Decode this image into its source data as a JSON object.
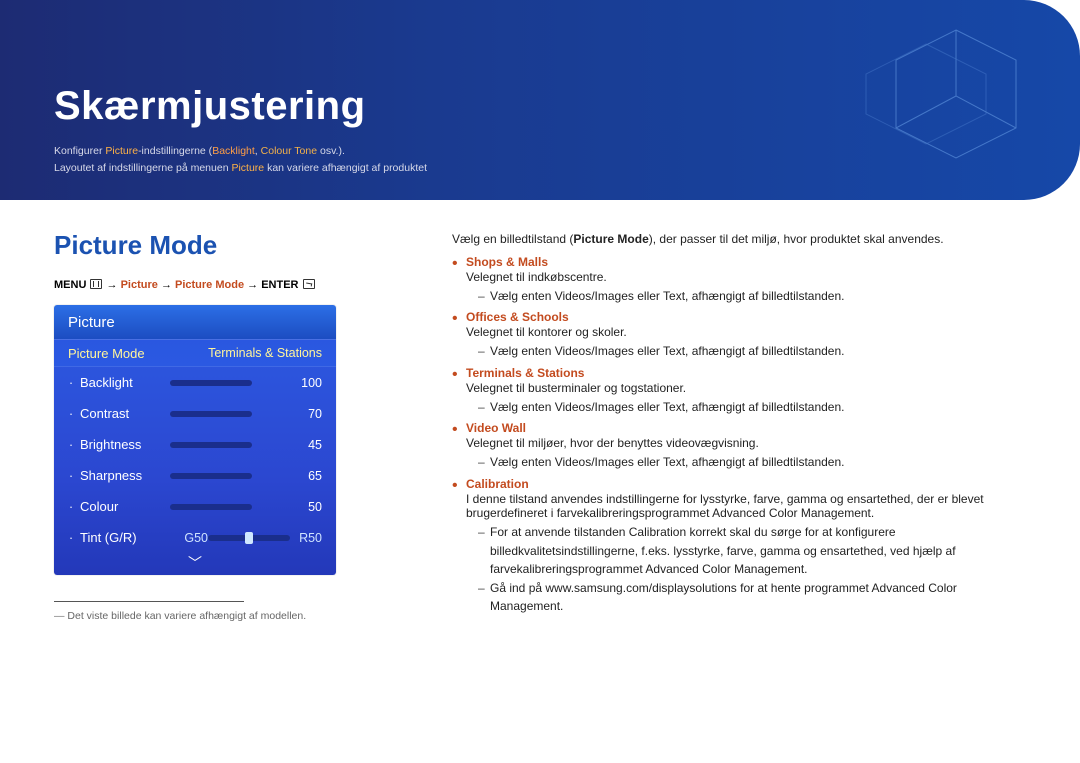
{
  "header": {
    "title": "Skærmjustering",
    "sub1_a": "Konfigurer ",
    "sub1_b": "Picture",
    "sub1_c": "-indstillingerne (",
    "sub1_d": "Backlight",
    "sub1_e": ", ",
    "sub1_f": "Colour Tone",
    "sub1_g": " osv.).",
    "sub2_a": "Layoutet af indstillingerne på menuen ",
    "sub2_b": "Picture",
    "sub2_c": " kan variere afhængigt af produktet"
  },
  "left": {
    "section_title": "Picture Mode",
    "bc_menu": "MENU",
    "bc_arrow": "→",
    "bc_picture": "Picture",
    "bc_mode": "Picture Mode",
    "bc_enter": "ENTER",
    "tv_header": "Picture",
    "sel_left": "Picture Mode",
    "sel_right": "Terminals & Stations",
    "rows": [
      {
        "label": "Backlight",
        "value": "100",
        "pct": 100
      },
      {
        "label": "Contrast",
        "value": "70",
        "pct": 70
      },
      {
        "label": "Brightness",
        "value": "45",
        "pct": 45
      },
      {
        "label": "Sharpness",
        "value": "65",
        "pct": 65
      },
      {
        "label": "Colour",
        "value": "50",
        "pct": 50
      }
    ],
    "tint_label": "Tint (G/R)",
    "tint_g": "G50",
    "tint_r": "R50",
    "tint_pos_pct": 50,
    "footnote": "Det viste billede kan variere afhængigt af modellen."
  },
  "right": {
    "intro_a": "Vælg en billedtilstand (",
    "intro_b": "Picture Mode",
    "intro_c": "), der passer til det miljø, hvor produktet skal anvendes.",
    "modes": [
      {
        "title": "Shops & Malls",
        "sub": "Velegnet til indkøbscentre.",
        "dash": [
          {
            "a": "Vælg enten ",
            "b": "Videos/Images",
            "c": " eller ",
            "d": "Text",
            "e": ", afhængigt af billedtilstanden."
          }
        ]
      },
      {
        "title": "Offices & Schools",
        "sub": "Velegnet til kontorer og skoler.",
        "dash": [
          {
            "a": "Vælg enten ",
            "b": "Videos/Images",
            "c": " eller ",
            "d": "Text",
            "e": ", afhængigt af billedtilstanden."
          }
        ]
      },
      {
        "title": "Terminals & Stations",
        "sub": "Velegnet til busterminaler og togstationer.",
        "dash": [
          {
            "a": "Vælg enten ",
            "b": "Videos/Images",
            "c": " eller ",
            "d": "Text",
            "e": ", afhængigt af billedtilstanden."
          }
        ]
      },
      {
        "title": "Video Wall",
        "sub": "Velegnet til miljøer, hvor der benyttes videovægvisning.",
        "dash": [
          {
            "a": "Vælg enten ",
            "b": "Videos/Images",
            "c": " eller ",
            "d": "Text",
            "e": ", afhængigt af billedtilstanden."
          }
        ]
      },
      {
        "title": "Calibration",
        "sub_long_a": "I denne tilstand anvendes indstillingerne for lysstyrke, farve, gamma og ensartethed, der er blevet brugerdefineret i farvekalibreringsprogrammet ",
        "sub_long_b": "Advanced Color Management",
        "sub_long_c": ".",
        "dash2": [
          {
            "a": "For at anvende tilstanden ",
            "b": "Calibration",
            "c": " korrekt skal du sørge for at konfigurere billedkvalitetsindstillingerne, f.eks. lysstyrke, farve, gamma og ensartethed, ved hjælp af farvekalibreringsprogrammet ",
            "d": "Advanced Color Management",
            "e": "."
          },
          {
            "a": "Gå ind på www.samsung.com/displaysolutions for at hente programmet ",
            "b": "Advanced Color Management",
            "c": "."
          }
        ]
      }
    ]
  }
}
